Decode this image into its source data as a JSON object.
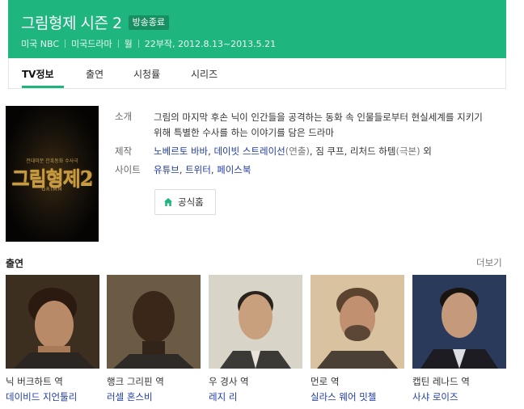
{
  "header": {
    "title": "그림형제 시즌 2",
    "badge": "방송종료",
    "meta": [
      "미국 NBC",
      "미국드라마",
      "월",
      "22부작, 2012.8.13~2013.5.21"
    ],
    "bg_color": "#1fb57f"
  },
  "tabs": [
    {
      "label": "TV정보",
      "active": true
    },
    {
      "label": "출연",
      "active": false
    },
    {
      "label": "시청률",
      "active": false
    },
    {
      "label": "시리즈",
      "active": false
    }
  ],
  "poster": {
    "sub": "전대미문 잔혹동화 수사극",
    "title": "그림형제2",
    "en": "GRIMM"
  },
  "info": {
    "synopsis_label": "소개",
    "synopsis": "그림의 마지막 후손 닉이 인간들을 공격하는 동화 속 인물들로부터 현실세계를 지키기 위해 특별한 수사를 하는 이야기를 담은 드라마",
    "production_label": "제작",
    "production": {
      "p1": "노베르토 바바",
      "sep1": ", ",
      "p2": "데이빗 스트레이선",
      "r2": "(연출)",
      "sep2": ", 짐 쿠프, 리처드 하템",
      "r3": "(극본)",
      "tail": " 외"
    },
    "site_label": "사이트",
    "sites": [
      "유튜브",
      "트위터",
      "페이스북"
    ],
    "site_sep": ", ",
    "home_button": "공식홈",
    "home_icon": "home-icon"
  },
  "cast_section": {
    "title": "출연",
    "more": "더보기",
    "cast": [
      {
        "role": "닉 버크하트 역",
        "actor": "데이비드 지언툴리"
      },
      {
        "role": "행크 그리핀 역",
        "actor": "러셀 혼스비"
      },
      {
        "role": "우 경사 역",
        "actor": "레지 리"
      },
      {
        "role": "먼로 역",
        "actor": "실라스 웨어 밋첼"
      },
      {
        "role": "캡틴 레나드 역",
        "actor": "사샤 로이즈"
      }
    ]
  }
}
